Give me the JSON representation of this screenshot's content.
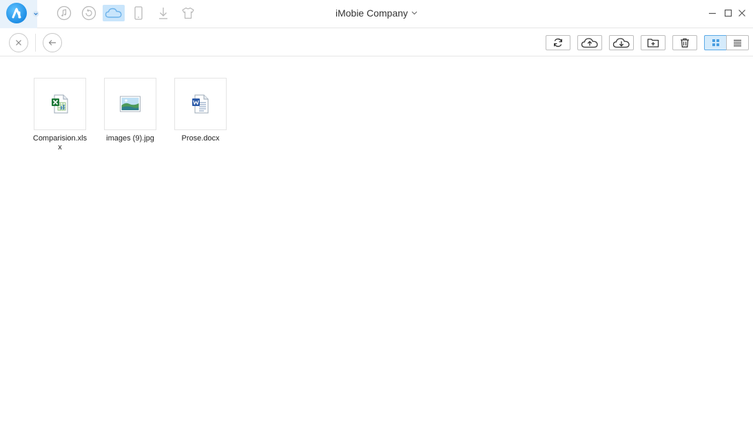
{
  "window": {
    "title": "iMobie Company"
  },
  "nav": {
    "icons": [
      {
        "name": "music-icon",
        "active": false
      },
      {
        "name": "restore-icon",
        "active": false
      },
      {
        "name": "cloud-icon",
        "active": true
      },
      {
        "name": "phone-icon",
        "active": false
      },
      {
        "name": "download-icon",
        "active": false
      },
      {
        "name": "tshirt-icon",
        "active": false
      }
    ]
  },
  "toolbar": {
    "buttons": [
      "refresh-icon",
      "cloud-upload-icon",
      "cloud-download-icon",
      "new-folder-icon",
      "trash-icon"
    ],
    "view": "grid"
  },
  "files": [
    {
      "name": "Comparision.xlsx",
      "type": "excel"
    },
    {
      "name": "images (9).jpg",
      "type": "image"
    },
    {
      "name": "Prose.docx",
      "type": "word"
    }
  ],
  "colors": {
    "accent": "#1f8fe6",
    "active_bg": "#c9e5fb"
  }
}
